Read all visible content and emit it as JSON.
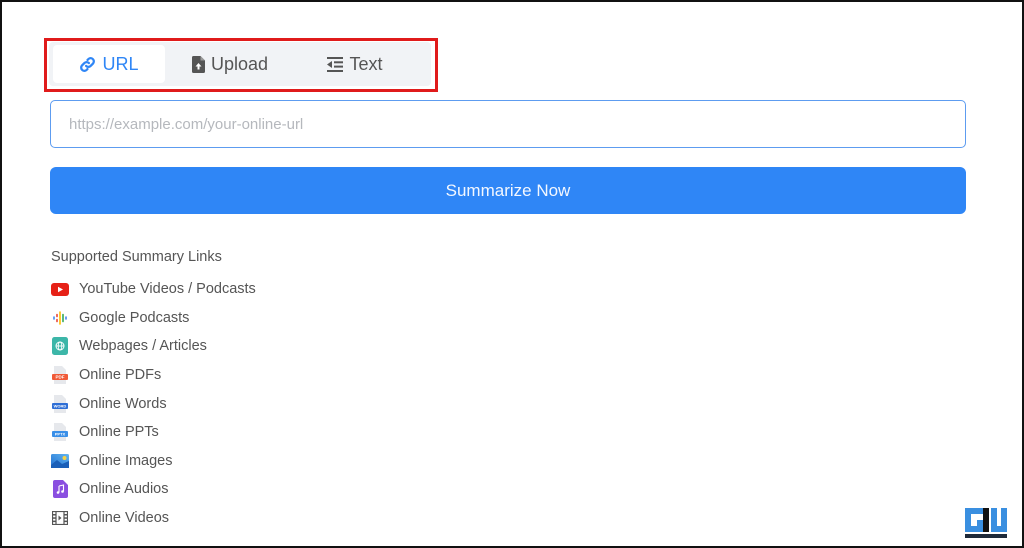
{
  "tabs": [
    {
      "label": "URL",
      "icon": "link-icon",
      "active": true
    },
    {
      "label": "Upload",
      "icon": "file-upload-icon",
      "active": false
    },
    {
      "label": "Text",
      "icon": "text-indent-icon",
      "active": false
    }
  ],
  "url_input": {
    "value": "",
    "placeholder": "https://example.com/your-online-url"
  },
  "summarize_button": {
    "label": "Summarize Now"
  },
  "supported": {
    "title": "Supported Summary Links",
    "items": [
      {
        "label": "YouTube Videos / Podcasts",
        "icon": "youtube-icon"
      },
      {
        "label": "Google Podcasts",
        "icon": "google-podcasts-icon"
      },
      {
        "label": "Webpages / Articles",
        "icon": "webpage-icon"
      },
      {
        "label": "Online PDFs",
        "icon": "pdf-file-icon"
      },
      {
        "label": "Online Words",
        "icon": "word-file-icon"
      },
      {
        "label": "Online PPTs",
        "icon": "pptx-file-icon"
      },
      {
        "label": "Online Images",
        "icon": "image-icon"
      },
      {
        "label": "Online Audios",
        "icon": "audio-file-icon"
      },
      {
        "label": "Online Videos",
        "icon": "video-film-icon"
      }
    ]
  },
  "colors": {
    "accent": "#2f86f6",
    "highlight_box": "#e01b1b",
    "youtube": "#e62117",
    "pdf": "#f05a38",
    "audio": "#8a4fe0"
  },
  "watermark": {
    "text": "GADGETS TO USE"
  }
}
